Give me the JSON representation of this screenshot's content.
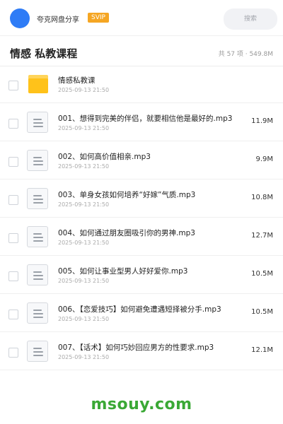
{
  "header": {
    "site_name": "夸克网盘分享",
    "badge": "SVIP",
    "search_placeholder": "搜索",
    "avatar_color": "#2f7cf6"
  },
  "folder": {
    "title": "情感 私教课程",
    "summary": "共 57 项 · 549.8M"
  },
  "files": [
    {
      "name": "情感私教课",
      "date": "2025-09-13 21:50",
      "size": "",
      "type": "folder"
    },
    {
      "name": "001、想得到完美的伴侣，就要相信他是最好的.mp3",
      "date": "2025-09-13 21:50",
      "size": "11.9M",
      "type": "file"
    },
    {
      "name": "002、如何高价值相亲.mp3",
      "date": "2025-09-13 21:50",
      "size": "9.9M",
      "type": "file"
    },
    {
      "name": "003、单身女孩如何培养“好嫁”气质.mp3",
      "date": "2025-09-13 21:50",
      "size": "10.8M",
      "type": "file"
    },
    {
      "name": "004、如何通过朋友圈吸引你的男神.mp3",
      "date": "2025-09-13 21:50",
      "size": "12.7M",
      "type": "file"
    },
    {
      "name": "005、如何让事业型男人好好爱你.mp3",
      "date": "2025-09-13 21:50",
      "size": "10.5M",
      "type": "file"
    },
    {
      "name": "006、【恋爱技巧】如何避免遭遇短择被分手.mp3",
      "date": "2025-09-13 21:50",
      "size": "10.5M",
      "type": "file"
    },
    {
      "name": "007、【话术】如何巧妙回应男方的性要求.mp3",
      "date": "2025-09-13 21:50",
      "size": "12.1M",
      "type": "file"
    }
  ],
  "footer": {
    "brand": "msouy.com",
    "brand_color": "#3aa835"
  }
}
